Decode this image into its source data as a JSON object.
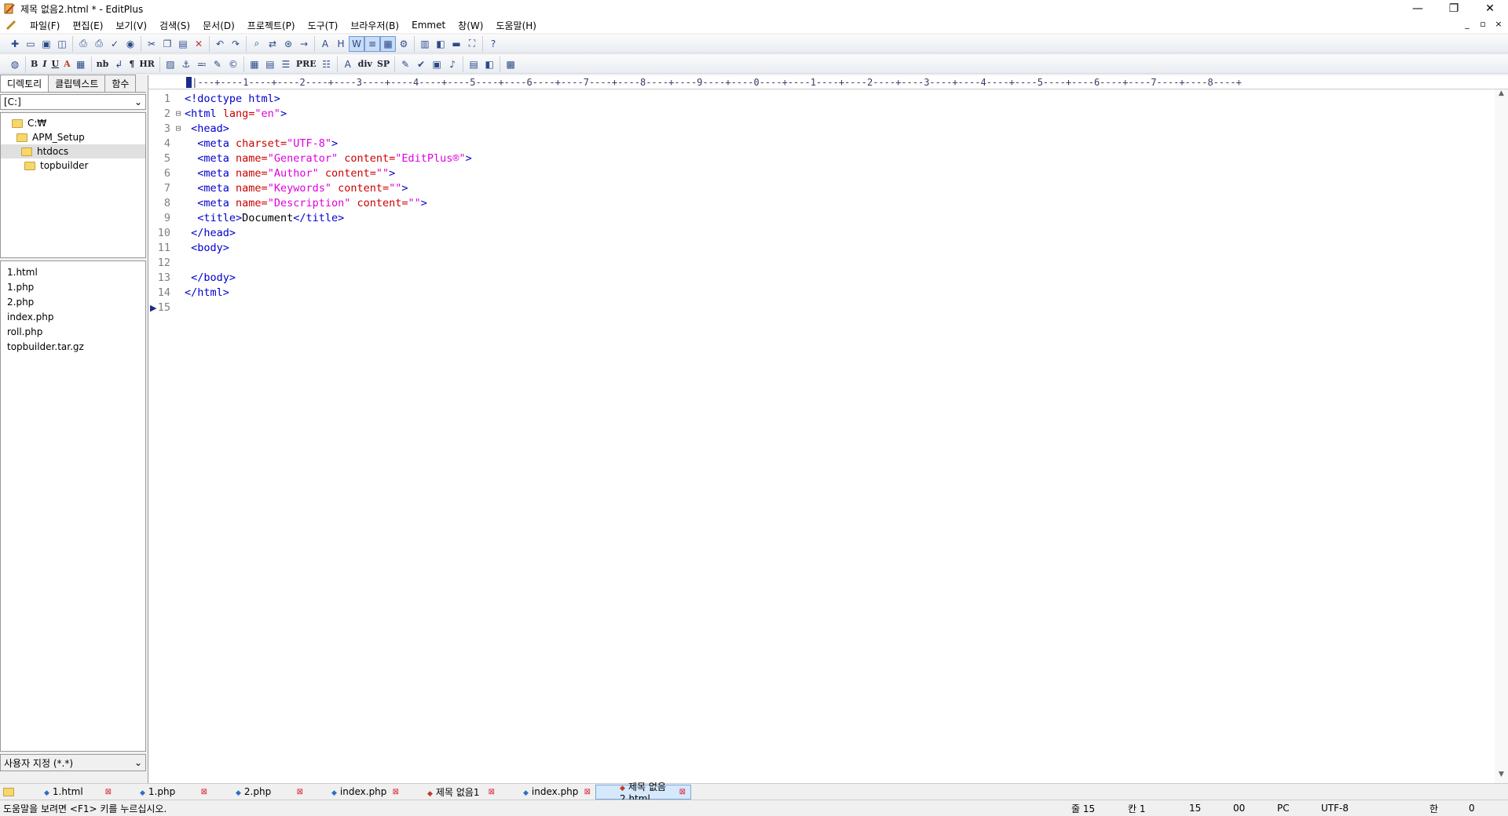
{
  "window": {
    "title": "제목 없음2.html * - EditPlus",
    "controls": [
      "—",
      "❐",
      "✕"
    ]
  },
  "menu": [
    "파일(F)",
    "편집(E)",
    "보기(V)",
    "검색(S)",
    "문서(D)",
    "프로젝트(P)",
    "도구(T)",
    "브라우저(B)",
    "Emmet",
    "창(W)",
    "도움말(H)"
  ],
  "mdi_controls": [
    "_",
    "▫",
    "×"
  ],
  "toolbar2_text": {
    "bold": "B",
    "italic": "I",
    "underline": "U",
    "color": "A",
    "nb": "nb",
    "para": "¶",
    "hr": "HR",
    "div": "div",
    "sp": "SP",
    "pre": "PRE"
  },
  "left_panel": {
    "tabs": [
      "디렉토리",
      "클립텍스트",
      "함수"
    ],
    "drive": "[C:]",
    "tree": [
      {
        "label": "C:₩",
        "indent": 0
      },
      {
        "label": "APM_Setup",
        "indent": 1
      },
      {
        "label": "htdocs",
        "indent": 2,
        "selected": true
      },
      {
        "label": "topbuilder",
        "indent": 3
      }
    ],
    "files": [
      "1.html",
      "1.php",
      "2.php",
      "index.php",
      "roll.php",
      "topbuilder.tar.gz"
    ],
    "filter": "사용자 지정 (*.*)"
  },
  "ruler": "|---+----1----+----2----+----3----+----4----+----5----+----6----+----7----+----8----+----9----+----0----+----1----+----2----+----3----+----4----+----5----+----6----+----7----+----8----+",
  "code_lines": [
    {
      "n": "1",
      "fold": "",
      "html": "<span class=\"tag\">&lt;!doctype html&gt;</span>"
    },
    {
      "n": "2",
      "fold": "⊟",
      "html": "<span class=\"tag\">&lt;html</span> <span class=\"attr\">lang=</span><span class=\"val\">\"en\"</span><span class=\"tag\">&gt;</span>"
    },
    {
      "n": "3",
      "fold": "⊟",
      "html": " <span class=\"tag\">&lt;head&gt;</span>"
    },
    {
      "n": "4",
      "fold": "",
      "html": "  <span class=\"tag\">&lt;meta</span> <span class=\"attr\">charset=</span><span class=\"val\">\"UTF-8\"</span><span class=\"tag\">&gt;</span>"
    },
    {
      "n": "5",
      "fold": "",
      "html": "  <span class=\"tag\">&lt;meta</span> <span class=\"attr\">name=</span><span class=\"val\">\"Generator\"</span> <span class=\"attr\">content=</span><span class=\"val\">\"EditPlus®\"</span><span class=\"tag\">&gt;</span>"
    },
    {
      "n": "6",
      "fold": "",
      "html": "  <span class=\"tag\">&lt;meta</span> <span class=\"attr\">name=</span><span class=\"val\">\"Author\"</span> <span class=\"attr\">content=</span><span class=\"val\">\"\"</span><span class=\"tag\">&gt;</span>"
    },
    {
      "n": "7",
      "fold": "",
      "html": "  <span class=\"tag\">&lt;meta</span> <span class=\"attr\">name=</span><span class=\"val\">\"Keywords\"</span> <span class=\"attr\">content=</span><span class=\"val\">\"\"</span><span class=\"tag\">&gt;</span>"
    },
    {
      "n": "8",
      "fold": "",
      "html": "  <span class=\"tag\">&lt;meta</span> <span class=\"attr\">name=</span><span class=\"val\">\"Description\"</span> <span class=\"attr\">content=</span><span class=\"val\">\"\"</span><span class=\"tag\">&gt;</span>"
    },
    {
      "n": "9",
      "fold": "",
      "html": "  <span class=\"tag\">&lt;title&gt;</span><span class=\"txtc\">Document</span><span class=\"tag\">&lt;/title&gt;</span>"
    },
    {
      "n": "10",
      "fold": "",
      "html": " <span class=\"tag\">&lt;/head&gt;</span>"
    },
    {
      "n": "11",
      "fold": "",
      "html": " <span class=\"tag\">&lt;body&gt;</span>"
    },
    {
      "n": "12",
      "fold": "",
      "html": ""
    },
    {
      "n": "13",
      "fold": "",
      "html": " <span class=\"tag\">&lt;/body&gt;</span>"
    },
    {
      "n": "14",
      "fold": "",
      "html": "<span class=\"tag\">&lt;/html&gt;</span>"
    },
    {
      "n": "15",
      "fold": "",
      "html": ""
    }
  ],
  "doc_tabs": [
    {
      "label": "1.html",
      "modified": false
    },
    {
      "label": "1.php",
      "modified": false
    },
    {
      "label": "2.php",
      "modified": false
    },
    {
      "label": "index.php",
      "modified": false
    },
    {
      "label": "제목 없음1",
      "modified": true
    },
    {
      "label": "index.php",
      "modified": false
    },
    {
      "label": "제목 없음2.html",
      "modified": true,
      "active": true
    }
  ],
  "status": {
    "message": "도움말을 보려면 <F1> 키를 누르십시오.",
    "line": "줄 15",
    "col": "칸 1",
    "total": "15",
    "code": "00",
    "eol": "PC",
    "encoding": "UTF-8",
    "ime": "한",
    "extra": "0"
  },
  "colors": {
    "tag": "#0000cc",
    "attr": "#cc0000",
    "value": "#dd00dd",
    "active_tab": "#d6e8fb"
  }
}
